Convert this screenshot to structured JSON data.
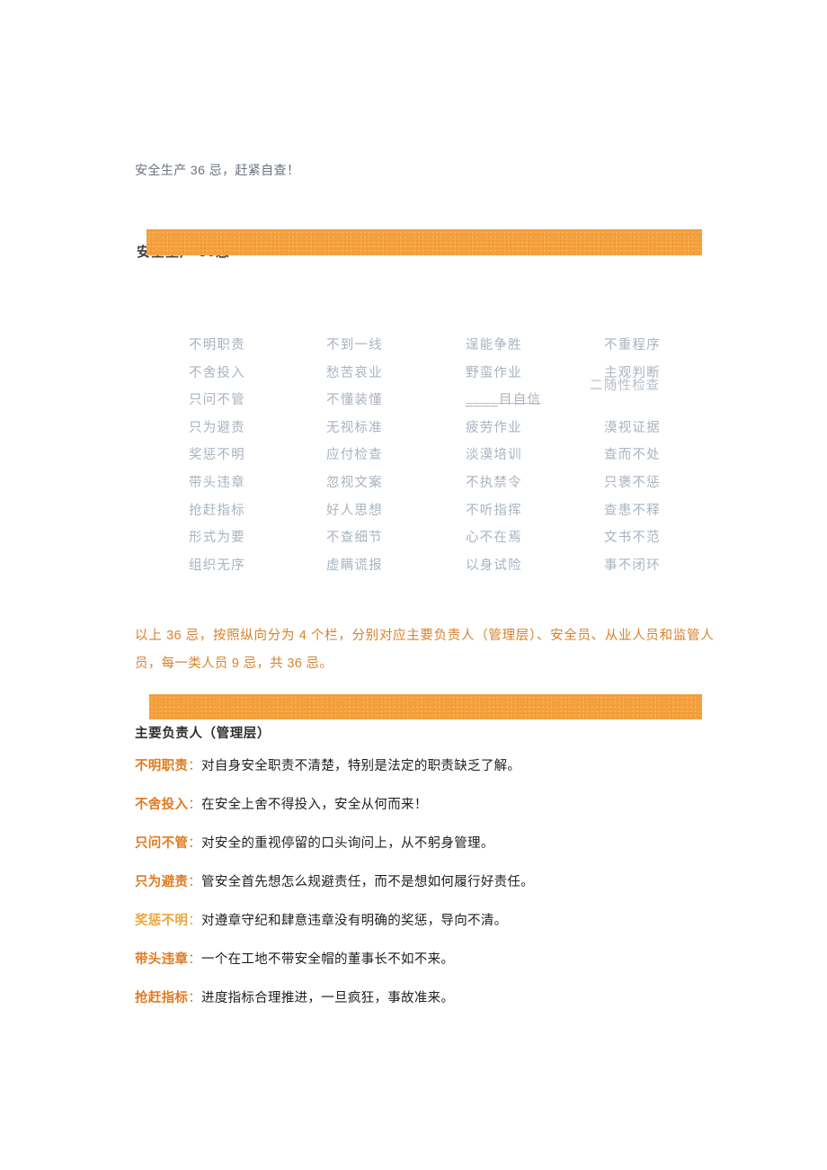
{
  "document": {
    "title": "安全生产 36 忌，赶紧自查！",
    "banner_heading": "安全生产  36忌"
  },
  "grid": {
    "columns": 4,
    "rows": [
      [
        "不明职责",
        "不到一线",
        "逞能争胜",
        "不重程序"
      ],
      [
        "不舍投入",
        "愁苦哀业",
        "野蛮作业",
        "主观判断"
      ],
      [
        "只问不管",
        "不懂装懂",
        "____目自信",
        "二随性检查"
      ],
      [
        "只为避责",
        "无视标准",
        "疲劳作业",
        "漠视证据"
      ],
      [
        "奖惩不明",
        "应付检查",
        "淡漠培训",
        "查而不处"
      ],
      [
        "带头违章",
        "忽视文案",
        "不执禁令",
        "只褒不惩"
      ],
      [
        "抢赶指标",
        "好人思想",
        "不听指挥",
        "查患不释"
      ],
      [
        "形式为要",
        "不查细节",
        "心不在焉",
        "文书不范"
      ],
      [
        "组织无序",
        "虚瞒谎报",
        "以身试险",
        "事不闭环"
      ]
    ]
  },
  "note": "以上 36 忌，按照纵向分为 4 个栏，分别对应主要负责人（管理层）、安全员、从业人员和监管人员，每一类人员 9 忌，共 36 忌。",
  "section": {
    "heading": "主要负责人（管理层）",
    "items": [
      {
        "term": "不明职责",
        "sep": "：",
        "text": "对自身安全职责不清楚，特别是法定的职责缺乏了解。",
        "highlight": false
      },
      {
        "term": "不舍投入",
        "sep": "：",
        "text": "在安全上舍不得投入，安全从何而来！",
        "highlight": false
      },
      {
        "term": "只问不管",
        "sep": "：",
        "text": "对安全的重视停留的口头询问上，从不躬身管理。",
        "highlight": false
      },
      {
        "term": "只为避责",
        "sep": "：",
        "text": "管安全首先想怎么规避责任，而不是想如何履行好责任。",
        "highlight": false
      },
      {
        "term": "奖惩不明",
        "sep": "：",
        "text": "对遵章守纪和肆意违章没有明确的奖惩，导向不清。",
        "highlight": true
      },
      {
        "term": "带头违章",
        "sep": "：",
        "text": "一个在工地不带安全帽的董事长不如不来。",
        "highlight": false
      },
      {
        "term": "抢赶指标",
        "sep": "：",
        "text": "进度指标合理推进，一旦疯狂，事故准来。",
        "highlight": false
      }
    ]
  },
  "colors": {
    "banner": "#f4a23f",
    "note_text": "#d9822b",
    "term": "#e07b20",
    "term_alt": "#e9a640",
    "grid_text": "#a9b3c0",
    "title_text": "#6b7280"
  }
}
